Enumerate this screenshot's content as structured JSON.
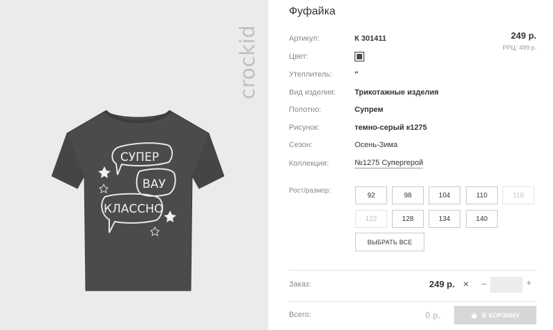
{
  "image": {
    "brand": "crockid",
    "tshirt_text": [
      "СУПЕР",
      "ВАУ",
      "КЛАССНО"
    ]
  },
  "product": {
    "title": "Фуфайка",
    "price": "249 р.",
    "rrp_label": "РРЦ:",
    "rrp_value": "499 р."
  },
  "attributes": [
    {
      "label": "Артикул:",
      "value": "К 301411"
    },
    {
      "label": "Цвет:",
      "value": ""
    },
    {
      "label": "Утеплитель:",
      "value": "\""
    },
    {
      "label": "Вид изделия:",
      "value": "Трикотажные изделия"
    },
    {
      "label": "Полотно:",
      "value": "Супрем"
    },
    {
      "label": "Рисунок:",
      "value": "темно-серый к1275"
    },
    {
      "label": "Сезон:",
      "value": "Осень-Зима"
    },
    {
      "label": "Коллекция:",
      "value": "№1275 Супергерой"
    }
  ],
  "colors": {
    "swatch": "#4a4a4a",
    "disabled": "#c4c4c4",
    "cart_button_bg": "#d7d7d7"
  },
  "sizes": {
    "label": "Рост/размер:",
    "options": [
      {
        "value": "92",
        "disabled": false
      },
      {
        "value": "98",
        "disabled": false
      },
      {
        "value": "104",
        "disabled": false
      },
      {
        "value": "110",
        "disabled": false
      },
      {
        "value": "116",
        "disabled": true
      },
      {
        "value": "122",
        "disabled": true
      },
      {
        "value": "128",
        "disabled": false
      },
      {
        "value": "134",
        "disabled": false
      },
      {
        "value": "140",
        "disabled": false
      }
    ],
    "select_all": "ВЫБРАТЬ ВСЕ"
  },
  "order": {
    "label": "Заказ:",
    "price": "249 р.",
    "times": "×",
    "minus": "–",
    "plus": "+",
    "quantity": ""
  },
  "total": {
    "label": "Всего:",
    "value": "0 р.",
    "cart_button": "В КОРЗИНУ",
    "cart_icon": "basket-icon"
  }
}
